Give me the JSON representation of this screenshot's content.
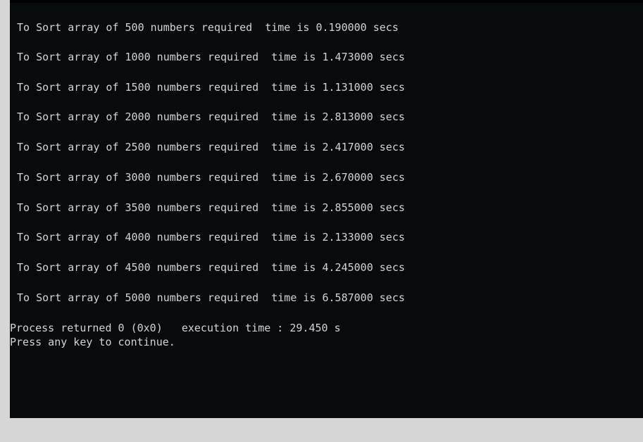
{
  "console": {
    "results": [
      "To Sort array of 500 numbers required  time is 0.190000 secs",
      "To Sort array of 1000 numbers required  time is 1.473000 secs",
      "To Sort array of 1500 numbers required  time is 1.131000 secs",
      "To Sort array of 2000 numbers required  time is 2.813000 secs",
      "To Sort array of 2500 numbers required  time is 2.417000 secs",
      "To Sort array of 3000 numbers required  time is 2.670000 secs",
      "To Sort array of 3500 numbers required  time is 2.855000 secs",
      "To Sort array of 4000 numbers required  time is 2.133000 secs",
      "To Sort array of 4500 numbers required  time is 4.245000 secs",
      "To Sort array of 5000 numbers required  time is 6.587000 secs"
    ],
    "process_returned": "Process returned 0 (0x0)   execution time : 29.450 s",
    "press_key": "Press any key to continue."
  },
  "colors": {
    "console_background": "#080b0b",
    "console_text": "#d4d4d4",
    "window_frame": "#d6d6d6"
  }
}
